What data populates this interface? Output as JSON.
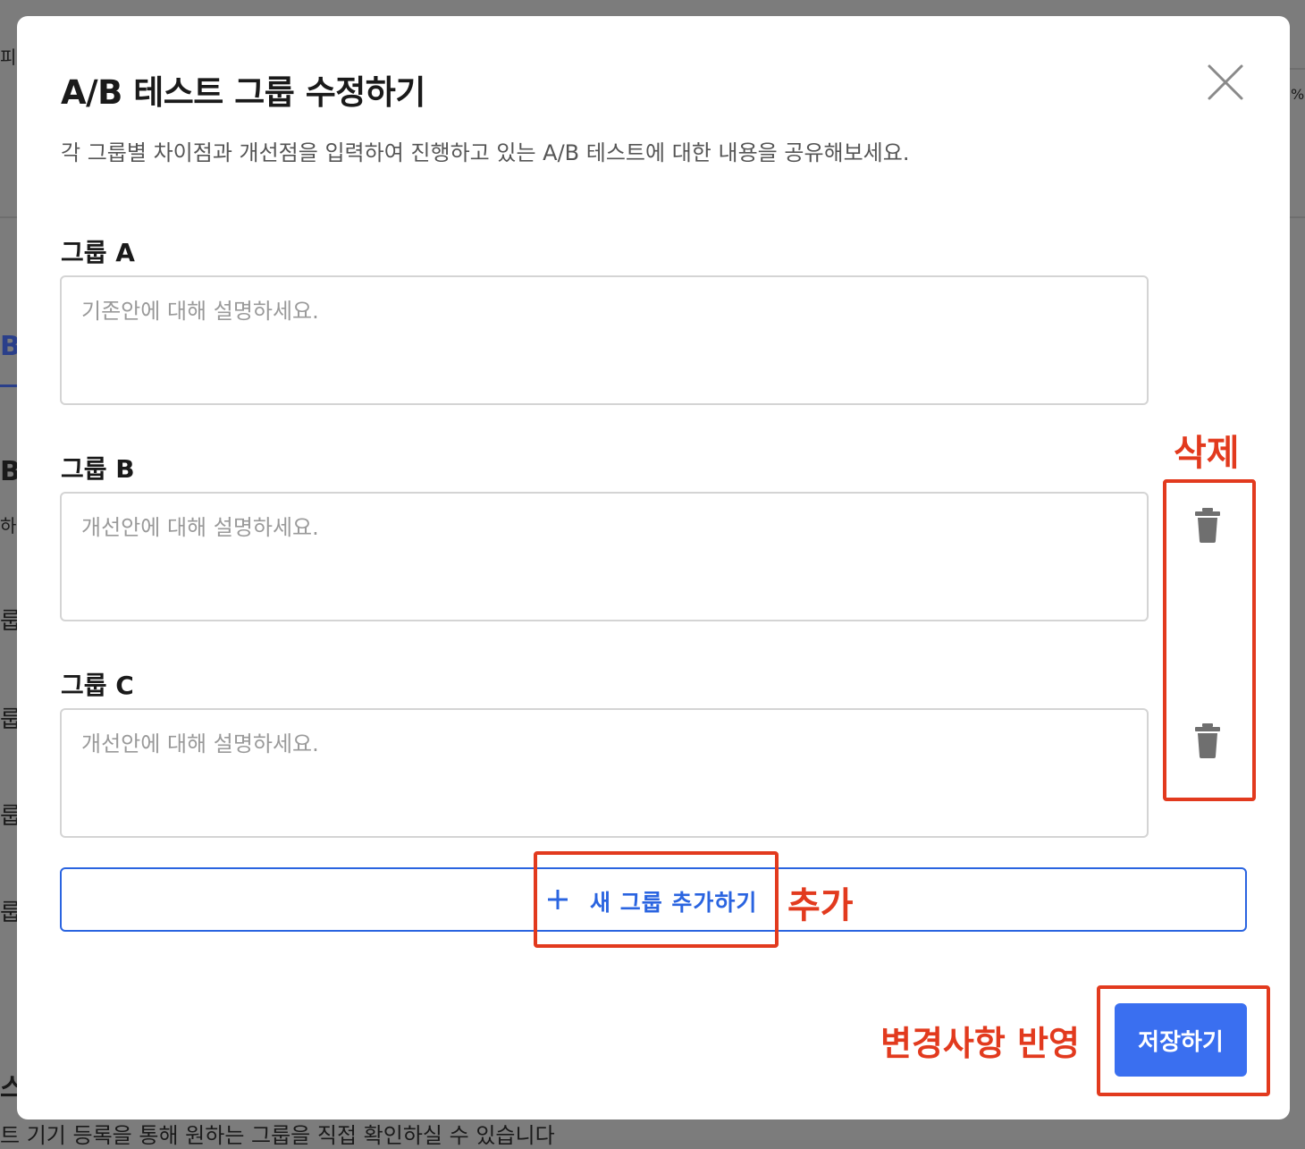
{
  "background": {
    "fragments": [
      "피",
      "%",
      "B",
      "B",
      "하",
      "룹",
      "룹",
      "룹",
      "룹",
      "스",
      "트 기기 등록을 통해 원하는 그룹을 직접 확인하실 수 있습니다"
    ]
  },
  "modal": {
    "title": "A/B 테스트 그룹 수정하기",
    "description": "각 그룹별 차이점과 개선점을 입력하여 진행하고 있는 A/B 테스트에 대한 내용을 공유해보세요.",
    "close_icon": "close-icon",
    "groups": [
      {
        "label": "그룹 A",
        "placeholder": "기존안에 대해 설명하세요.",
        "value": ""
      },
      {
        "label": "그룹 B",
        "placeholder": "개선안에 대해 설명하세요.",
        "value": ""
      },
      {
        "label": "그룹 C",
        "placeholder": "개선안에 대해 설명하세요.",
        "value": ""
      }
    ],
    "trash_icon": "trash-icon",
    "add_group": {
      "icon": "plus-icon",
      "label": "새 그룹 추가하기"
    },
    "save_label": "저장하기"
  },
  "annotations": {
    "delete": "삭제",
    "add": "추가",
    "apply_changes": "변경사항 반영"
  },
  "colors": {
    "primary": "#3a6ff0",
    "outline_blue": "#2a64e0",
    "annotation_red": "#e23a1e",
    "overlay": "#7a7a7a"
  }
}
